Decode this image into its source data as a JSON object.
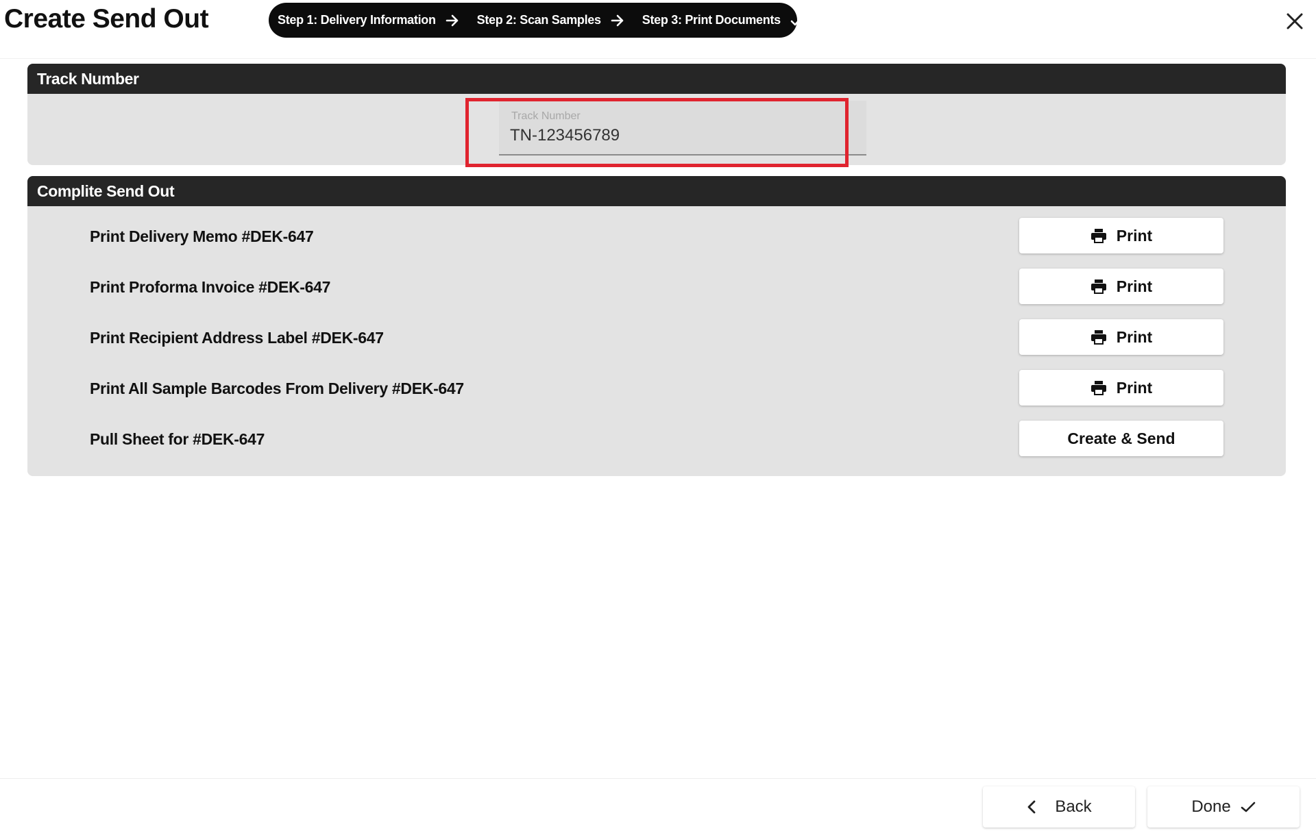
{
  "header": {
    "title": "Create Send Out",
    "steps": [
      {
        "label": "Step 1: Delivery Information",
        "icon": "arrow-right-icon"
      },
      {
        "label": "Step 2: Scan Samples",
        "icon": "arrow-right-icon"
      },
      {
        "label": "Step 3: Print Documents",
        "icon": "check-icon"
      }
    ],
    "close_icon": "close-icon"
  },
  "track_panel": {
    "title": "Track Number",
    "field_label": "Track Number",
    "field_value": "TN-123456789",
    "highlight_color": "#e0242f"
  },
  "send_panel": {
    "title": "Complite Send Out",
    "rows": [
      {
        "label": "Print Delivery Memo #DEK-647",
        "button": "Print",
        "icon": "printer-icon"
      },
      {
        "label": "Print Proforma Invoice #DEK-647",
        "button": "Print",
        "icon": "printer-icon"
      },
      {
        "label": "Print Recipient Address Label #DEK-647",
        "button": "Print",
        "icon": "printer-icon"
      },
      {
        "label": "Print All Sample Barcodes From Delivery #DEK-647",
        "button": "Print",
        "icon": "printer-icon"
      },
      {
        "label": "Pull Sheet for #DEK-647",
        "button": "Create & Send",
        "icon": null
      }
    ]
  },
  "footer": {
    "back_label": "Back",
    "back_icon": "chevron-left-icon",
    "done_label": "Done",
    "done_icon": "check-icon"
  },
  "colors": {
    "stepper_bg": "#0c0c0c",
    "panel_header_bg": "#262626",
    "panel_bg": "#e3e3e3",
    "highlight": "#e0242f"
  }
}
